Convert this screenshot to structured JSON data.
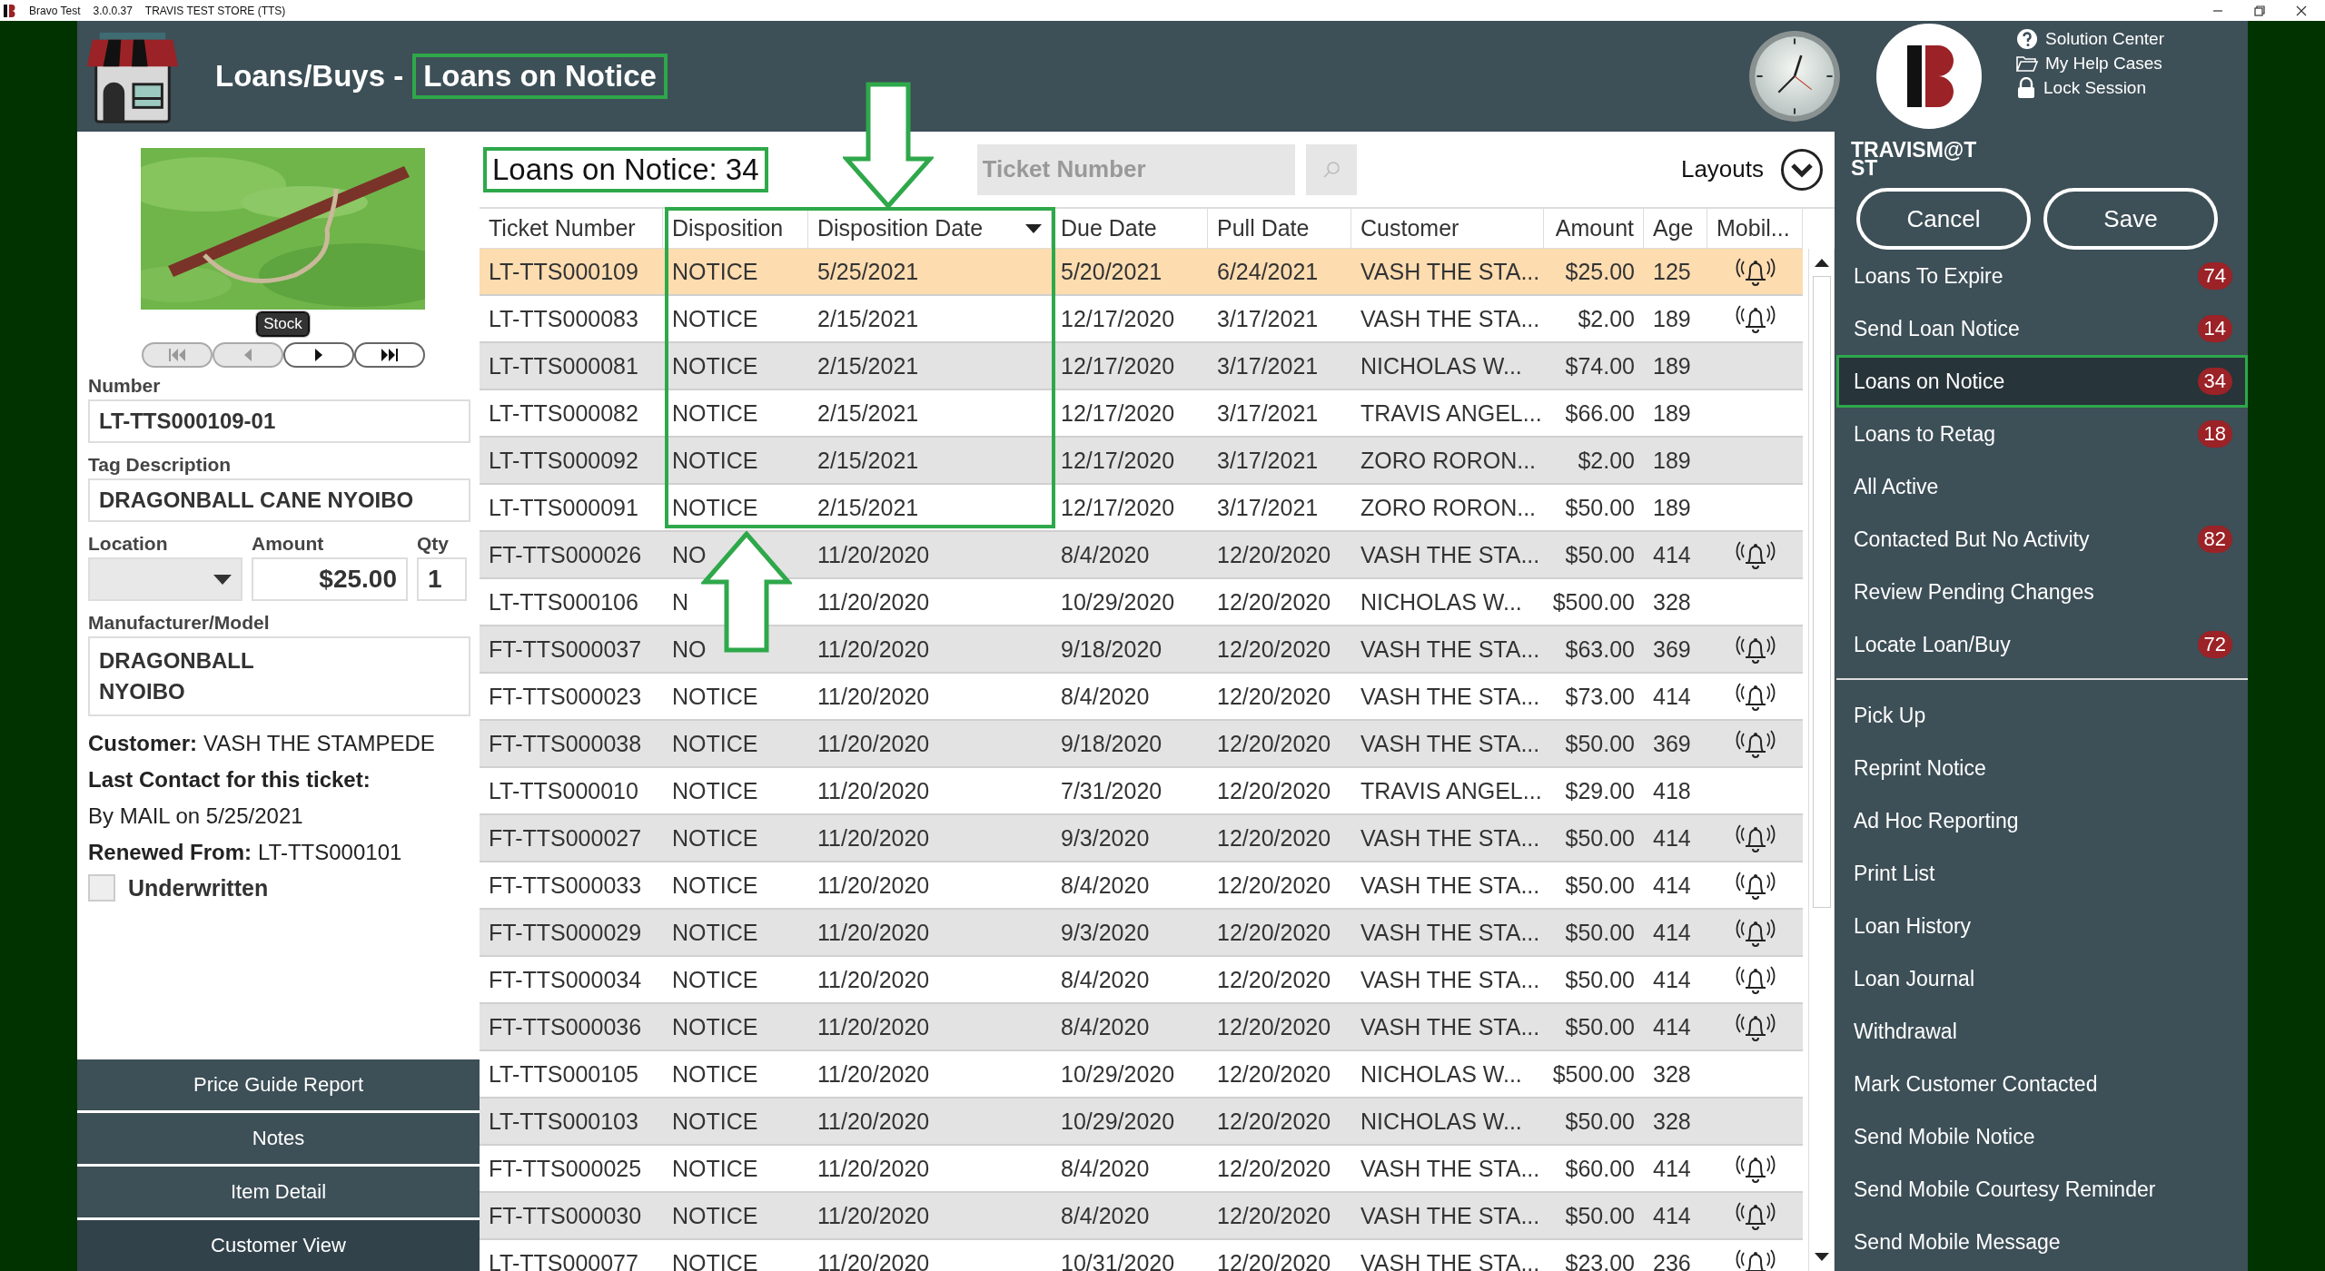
{
  "title_bar": {
    "app_name": "Bravo Test",
    "version": "3.0.0.37",
    "store": "TRAVIS TEST STORE (TTS)"
  },
  "header": {
    "section": "Loans/Buys -",
    "page": "Loans on Notice",
    "page_highlighted": true
  },
  "help_links": [
    {
      "kind": "help",
      "label": "Solution Center"
    },
    {
      "kind": "folder",
      "label": "My Help Cases"
    },
    {
      "kind": "lock",
      "label": "Lock Session"
    }
  ],
  "user": "TRAVISM@TST",
  "item_panel": {
    "stock_badge": "Stock",
    "image_nav": [
      {
        "kind": "first",
        "disabled": true
      },
      {
        "kind": "prev",
        "disabled": true
      },
      {
        "kind": "next",
        "disabled": false
      },
      {
        "kind": "last",
        "disabled": false
      }
    ],
    "number": {
      "label": "Number",
      "value": "LT-TTS000109-01"
    },
    "tag_description": {
      "label": "Tag Description",
      "value": "DRAGONBALL CANE NYOIBO"
    },
    "location": {
      "label": "Location"
    },
    "amount": {
      "label": "Amount",
      "value": "$25.00"
    },
    "qty": {
      "label": "Qty",
      "value": "1"
    },
    "manufacturer_model": {
      "label": "Manufacturer/Model",
      "lines": [
        "DRAGONBALL",
        "NYOIBO"
      ]
    },
    "info": [
      {
        "label": "Customer:",
        "value": "VASH THE STAMPEDE"
      },
      {
        "label": "Last Contact for this ticket:"
      },
      {
        "value": "By MAIL on 5/25/2021"
      },
      {
        "label": "Renewed From:",
        "value": "LT-TTS000101"
      }
    ],
    "underwritten": {
      "label": "Underwritten",
      "checked": false
    }
  },
  "bottom_buttons": [
    {
      "label": "Price Guide Report",
      "selected": false
    },
    {
      "label": "Notes",
      "selected": false
    },
    {
      "label": "Item Detail",
      "selected": false
    },
    {
      "label": "Customer View",
      "selected": true
    }
  ],
  "list_header": {
    "count_label": "Loans on Notice: 34",
    "count_highlighted": true,
    "search": {
      "placeholder": "Ticket Number"
    },
    "layouts": "Layouts"
  },
  "table": {
    "columns": [
      {
        "label": "Ticket Number",
        "sorted": false
      },
      {
        "label": "Disposition",
        "sorted": false
      },
      {
        "label": "Disposition Date",
        "sorted": true
      },
      {
        "label": "Due Date",
        "sorted": false
      },
      {
        "label": "Pull Date",
        "sorted": false
      },
      {
        "label": "Customer",
        "sorted": false
      },
      {
        "label": "Amount",
        "sorted": false
      },
      {
        "label": "Age",
        "sorted": false
      },
      {
        "label": "Mobil...",
        "sorted": false
      }
    ],
    "rows": [
      {
        "cells": [
          "LT-TTS000109",
          "NOTICE",
          "5/25/2021",
          "5/20/2021",
          "6/24/2021",
          "VASH THE STA...",
          "$25.00",
          "125"
        ],
        "mobile_alert": true,
        "selected": true
      },
      {
        "cells": [
          "LT-TTS000083",
          "NOTICE",
          "2/15/2021",
          "12/17/2020",
          "3/17/2021",
          "VASH THE STA...",
          "$2.00",
          "189"
        ],
        "mobile_alert": true,
        "selected": false
      },
      {
        "cells": [
          "LT-TTS000081",
          "NOTICE",
          "2/15/2021",
          "12/17/2020",
          "3/17/2021",
          "NICHOLAS W...",
          "$74.00",
          "189"
        ],
        "mobile_alert": false,
        "selected": false
      },
      {
        "cells": [
          "LT-TTS000082",
          "NOTICE",
          "2/15/2021",
          "12/17/2020",
          "3/17/2021",
          "TRAVIS ANGEL...",
          "$66.00",
          "189"
        ],
        "mobile_alert": false,
        "selected": false
      },
      {
        "cells": [
          "LT-TTS000092",
          "NOTICE",
          "2/15/2021",
          "12/17/2020",
          "3/17/2021",
          "ZORO RORON...",
          "$2.00",
          "189"
        ],
        "mobile_alert": false,
        "selected": false
      },
      {
        "cells": [
          "LT-TTS000091",
          "NOTICE",
          "2/15/2021",
          "12/17/2020",
          "3/17/2021",
          "ZORO RORON...",
          "$50.00",
          "189"
        ],
        "mobile_alert": false,
        "selected": false
      },
      {
        "cells": [
          "FT-TTS000026",
          "NO",
          "11/20/2020",
          "8/4/2020",
          "12/20/2020",
          "VASH THE STA...",
          "$50.00",
          "414"
        ],
        "mobile_alert": true,
        "selected": false
      },
      {
        "cells": [
          "LT-TTS000106",
          "N",
          "11/20/2020",
          "10/29/2020",
          "12/20/2020",
          "NICHOLAS W...",
          "$500.00",
          "328"
        ],
        "mobile_alert": false,
        "selected": false
      },
      {
        "cells": [
          "FT-TTS000037",
          "NO",
          "11/20/2020",
          "9/18/2020",
          "12/20/2020",
          "VASH THE STA...",
          "$63.00",
          "369"
        ],
        "mobile_alert": true,
        "selected": false
      },
      {
        "cells": [
          "FT-TTS000023",
          "NOTICE",
          "11/20/2020",
          "8/4/2020",
          "12/20/2020",
          "VASH THE STA...",
          "$73.00",
          "414"
        ],
        "mobile_alert": true,
        "selected": false
      },
      {
        "cells": [
          "FT-TTS000038",
          "NOTICE",
          "11/20/2020",
          "9/18/2020",
          "12/20/2020",
          "VASH THE STA...",
          "$50.00",
          "369"
        ],
        "mobile_alert": true,
        "selected": false
      },
      {
        "cells": [
          "LT-TTS000010",
          "NOTICE",
          "11/20/2020",
          "7/31/2020",
          "12/20/2020",
          "TRAVIS ANGEL...",
          "$29.00",
          "418"
        ],
        "mobile_alert": false,
        "selected": false
      },
      {
        "cells": [
          "FT-TTS000027",
          "NOTICE",
          "11/20/2020",
          "9/3/2020",
          "12/20/2020",
          "VASH THE STA...",
          "$50.00",
          "414"
        ],
        "mobile_alert": true,
        "selected": false
      },
      {
        "cells": [
          "FT-TTS000033",
          "NOTICE",
          "11/20/2020",
          "8/4/2020",
          "12/20/2020",
          "VASH THE STA...",
          "$50.00",
          "414"
        ],
        "mobile_alert": true,
        "selected": false
      },
      {
        "cells": [
          "FT-TTS000029",
          "NOTICE",
          "11/20/2020",
          "9/3/2020",
          "12/20/2020",
          "VASH THE STA...",
          "$50.00",
          "414"
        ],
        "mobile_alert": true,
        "selected": false
      },
      {
        "cells": [
          "FT-TTS000034",
          "NOTICE",
          "11/20/2020",
          "8/4/2020",
          "12/20/2020",
          "VASH THE STA...",
          "$50.00",
          "414"
        ],
        "mobile_alert": true,
        "selected": false
      },
      {
        "cells": [
          "FT-TTS000036",
          "NOTICE",
          "11/20/2020",
          "8/4/2020",
          "12/20/2020",
          "VASH THE STA...",
          "$50.00",
          "414"
        ],
        "mobile_alert": true,
        "selected": false
      },
      {
        "cells": [
          "LT-TTS000105",
          "NOTICE",
          "11/20/2020",
          "10/29/2020",
          "12/20/2020",
          "NICHOLAS W...",
          "$500.00",
          "328"
        ],
        "mobile_alert": false,
        "selected": false
      },
      {
        "cells": [
          "LT-TTS000103",
          "NOTICE",
          "11/20/2020",
          "10/29/2020",
          "12/20/2020",
          "NICHOLAS W...",
          "$50.00",
          "328"
        ],
        "mobile_alert": false,
        "selected": false
      },
      {
        "cells": [
          "FT-TTS000025",
          "NOTICE",
          "11/20/2020",
          "8/4/2020",
          "12/20/2020",
          "VASH THE STA...",
          "$60.00",
          "414"
        ],
        "mobile_alert": true,
        "selected": false
      },
      {
        "cells": [
          "FT-TTS000030",
          "NOTICE",
          "11/20/2020",
          "8/4/2020",
          "12/20/2020",
          "VASH THE STA...",
          "$50.00",
          "414"
        ],
        "mobile_alert": true,
        "selected": false
      },
      {
        "cells": [
          "LT-TTS000077",
          "NOTICE",
          "11/20/2020",
          "10/31/2020",
          "12/20/2020",
          "VASH THE STA...",
          "$23.00",
          "236"
        ],
        "mobile_alert": true,
        "selected": false
      }
    ]
  },
  "actions": [
    "Cancel",
    "Save"
  ],
  "sidebar": {
    "groups": [
      [
        {
          "label": "Loans To Expire",
          "badge": "74",
          "selected": false,
          "highlighted": false
        },
        {
          "label": "Send Loan Notice",
          "badge": "14",
          "selected": false,
          "highlighted": false
        },
        {
          "label": "Loans on Notice",
          "badge": "34",
          "selected": true,
          "highlighted": true
        },
        {
          "label": "Loans to Retag",
          "badge": "18",
          "selected": false,
          "highlighted": false
        },
        {
          "label": "All Active",
          "selected": false,
          "highlighted": false
        },
        {
          "label": "Contacted But No Activity",
          "badge": "82",
          "selected": false,
          "highlighted": false
        },
        {
          "label": "Review Pending Changes",
          "selected": false,
          "highlighted": false
        },
        {
          "label": "Locate Loan/Buy",
          "badge": "72",
          "selected": false,
          "highlighted": false
        }
      ],
      [
        {
          "label": "Pick Up",
          "selected": false,
          "highlighted": false
        },
        {
          "label": "Reprint Notice",
          "selected": false,
          "highlighted": false
        },
        {
          "label": "Ad Hoc Reporting",
          "selected": false,
          "highlighted": false
        },
        {
          "label": "Print List",
          "selected": false,
          "highlighted": false
        },
        {
          "label": "Loan History",
          "selected": false,
          "highlighted": false
        },
        {
          "label": "Loan Journal",
          "selected": false,
          "highlighted": false
        },
        {
          "label": "Withdrawal",
          "selected": false,
          "highlighted": false
        },
        {
          "label": "Mark Customer Contacted",
          "selected": false,
          "highlighted": false
        },
        {
          "label": "Send Mobile Notice",
          "selected": false,
          "highlighted": false
        },
        {
          "label": "Send Mobile Courtesy Reminder",
          "selected": false,
          "highlighted": false
        },
        {
          "label": "Send Mobile Message",
          "selected": false,
          "highlighted": false
        }
      ]
    ]
  }
}
